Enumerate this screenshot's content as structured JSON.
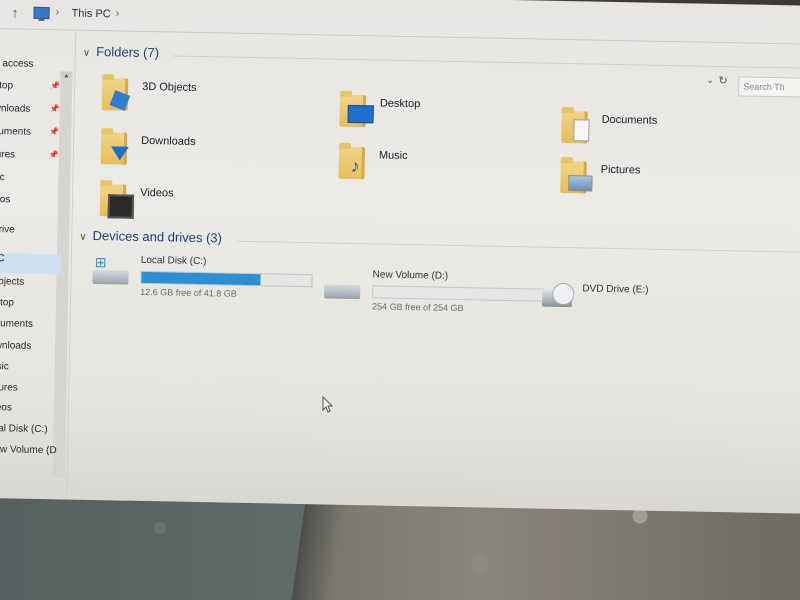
{
  "address": {
    "path": "This PC"
  },
  "search": {
    "placeholder": "Search Th"
  },
  "sidebar": {
    "items": [
      {
        "label": "k access",
        "pinned": false
      },
      {
        "label": "ktop",
        "pinned": true
      },
      {
        "label": "wnloads",
        "pinned": true
      },
      {
        "label": "cuments",
        "pinned": true
      },
      {
        "label": "tures",
        "pinned": true
      },
      {
        "label": "sic",
        "pinned": false
      },
      {
        "label": "leos",
        "pinned": false
      },
      {
        "label": "Drive",
        "pinned": false
      },
      {
        "label": "PC",
        "pinned": false,
        "selected": true
      },
      {
        "label": "Objects",
        "pinned": false
      },
      {
        "label": "sktop",
        "pinned": false
      },
      {
        "label": "ocuments",
        "pinned": false
      },
      {
        "label": "ownloads",
        "pinned": false
      },
      {
        "label": "lusic",
        "pinned": false
      },
      {
        "label": "ictures",
        "pinned": false
      },
      {
        "label": "ideos",
        "pinned": false
      },
      {
        "label": "ocal Disk (C:)",
        "pinned": false
      },
      {
        "label": "New Volume (D:",
        "pinned": false
      }
    ]
  },
  "folders_section": {
    "title": "Folders (7)"
  },
  "folders": [
    {
      "name": "3D Objects",
      "icon": "3d-objects-icon"
    },
    {
      "name": "Desktop",
      "icon": "desktop-icon"
    },
    {
      "name": "Documents",
      "icon": "documents-icon"
    },
    {
      "name": "Downloads",
      "icon": "downloads-icon"
    },
    {
      "name": "Music",
      "icon": "music-icon"
    },
    {
      "name": "Pictures",
      "icon": "pictures-icon"
    },
    {
      "name": "Videos",
      "icon": "videos-icon"
    }
  ],
  "drives_section": {
    "title": "Devices and drives (3)"
  },
  "drives": [
    {
      "name": "Local Disk (C:)",
      "free_text": "12.6 GB free of 41.8 GB",
      "used_fraction": 0.7
    },
    {
      "name": "New Volume (D:)",
      "free_text": "254 GB free of 254 GB",
      "used_fraction": 0.0
    },
    {
      "name": "DVD Drive (E:)",
      "free_text": "",
      "used_fraction": null
    }
  ],
  "colors": {
    "accent": "#2b8fd6",
    "header_text": "#1e3f78"
  }
}
